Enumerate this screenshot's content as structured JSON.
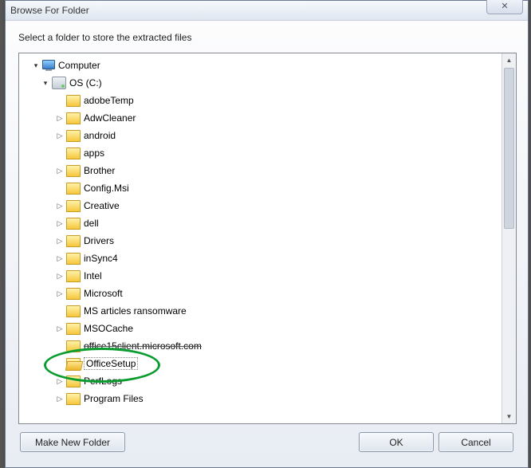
{
  "window": {
    "title": "Browse For Folder",
    "close_glyph": "✕"
  },
  "instruction": "Select a folder to store the extracted files",
  "tree": {
    "root": {
      "label": "Computer",
      "expanded": true
    },
    "drive": {
      "label": "OS (C:)",
      "expanded": true
    },
    "folders": [
      {
        "label": "adobeTemp",
        "expander": "none"
      },
      {
        "label": "AdwCleaner",
        "expander": "right"
      },
      {
        "label": "android",
        "expander": "right"
      },
      {
        "label": "apps",
        "expander": "none"
      },
      {
        "label": "Brother",
        "expander": "right"
      },
      {
        "label": "Config.Msi",
        "expander": "none"
      },
      {
        "label": "Creative",
        "expander": "right"
      },
      {
        "label": "dell",
        "expander": "right"
      },
      {
        "label": "Drivers",
        "expander": "right"
      },
      {
        "label": "inSync4",
        "expander": "right"
      },
      {
        "label": "Intel",
        "expander": "right"
      },
      {
        "label": "Microsoft",
        "expander": "right"
      },
      {
        "label": "MS articles ransomware",
        "expander": "none"
      },
      {
        "label": "MSOCache",
        "expander": "right"
      },
      {
        "label": "office15client.microsoft.com",
        "expander": "none",
        "struck": true
      },
      {
        "label": "OfficeSetup",
        "expander": "none",
        "selected": true,
        "open": true,
        "highlighted": true
      },
      {
        "label": "PerfLogs",
        "expander": "right",
        "struck": true
      },
      {
        "label": "Program Files",
        "expander": "right"
      }
    ]
  },
  "buttons": {
    "make_new_folder": "Make New Folder",
    "ok": "OK",
    "cancel": "Cancel"
  },
  "layout": {
    "indent_root": 14,
    "indent_drive": 26,
    "indent_folder": 44
  },
  "colors": {
    "highlight": "#0a9c2f"
  }
}
